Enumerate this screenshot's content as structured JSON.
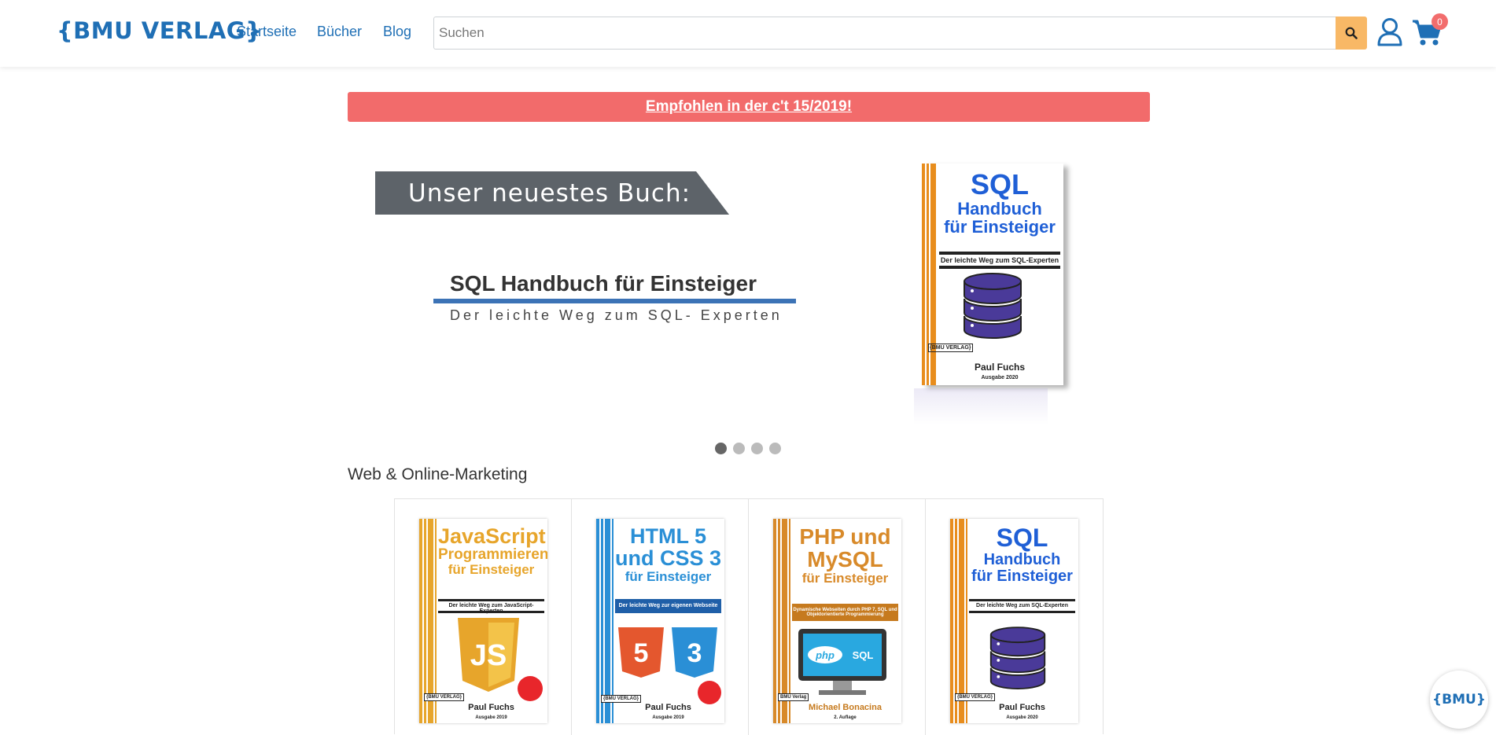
{
  "header": {
    "logo_text": "{BMU VERLAG}",
    "nav": [
      {
        "label": "Startseite"
      },
      {
        "label": "Bücher"
      },
      {
        "label": "Blog"
      }
    ],
    "search_placeholder": "Suchen",
    "cart_count": "0",
    "icons": [
      "search-icon",
      "user-icon",
      "cart-icon"
    ],
    "accent_color": "#1f6fb5",
    "search_button_color": "#f8b866"
  },
  "promo": {
    "text": "Empfohlen in der c't 15/2019!",
    "color": "#f26b6b"
  },
  "slider": {
    "tag": "Unser neuestes Buch:",
    "title": "SQL Handbuch für Einsteiger",
    "subtitle": "Der leichte Weg zum SQL- Experten",
    "cover": {
      "title_lines": [
        "SQL",
        "Handbuch",
        "für Einsteiger"
      ],
      "band": "Der leichte Weg zum SQL-Experten",
      "author": "Paul Fuchs",
      "edition": "Ausgabe 2020",
      "logo": "{BMU VERLAG}"
    },
    "dots_total": 4,
    "active_dot": 1
  },
  "section": {
    "title": "Web & Online-Marketing"
  },
  "books": [
    {
      "title_lines": [
        "JavaScript",
        "Programmieren",
        "für Einsteiger"
      ],
      "band": "Der leichte Weg zum JavaScript-Experten",
      "author": "Paul Fuchs",
      "edition": "Ausgabe 2019",
      "logo": "{BMU VERLAG}",
      "color": "#e7a52b",
      "art": "js-logo-icon"
    },
    {
      "title_lines": [
        "HTML 5",
        "und CSS 3",
        "für Einsteiger"
      ],
      "band": "Der leichte Weg zur eigenen Webseite",
      "author": "Paul Fuchs",
      "edition": "Ausgabe 2019",
      "logo": "{BMU VERLAG}",
      "color": "#2a8fd6",
      "art": "html5-css3-logo-icon"
    },
    {
      "title_lines": [
        "PHP und",
        "MySQL",
        "für Einsteiger"
      ],
      "band": "Dynamische Webseiten durch PHP 7, SQL und Objektorientierte Programmierung",
      "author": "Michael Bonacina",
      "edition": "2. Auflage",
      "logo": "BMU Verlag",
      "color": "#d88a2a",
      "art": "monitor-php-sql-icon"
    },
    {
      "title_lines": [
        "SQL",
        "Handbuch",
        "für Einsteiger"
      ],
      "band": "Der leichte Weg zum SQL-Experten",
      "author": "Paul Fuchs",
      "edition": "Ausgabe 2020",
      "logo": "{BMU VERLAG}",
      "color": "#1f5fd6",
      "art": "database-icon"
    }
  ],
  "chat_button": {
    "label": "{BMU}"
  }
}
